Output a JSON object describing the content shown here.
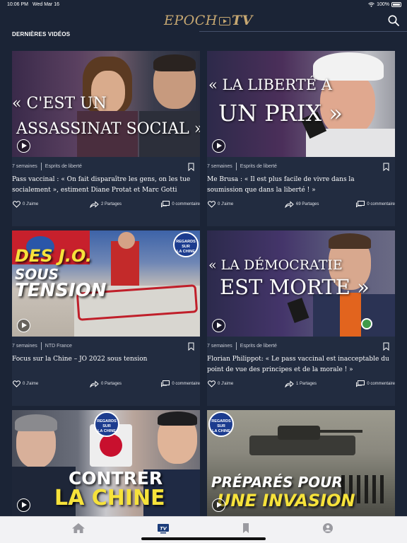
{
  "status": {
    "time": "10:06 PM",
    "date": "Wed Mar 16",
    "battery": "100%",
    "battery_level": 1.0
  },
  "header": {
    "logo_text": "EPOCH",
    "logo_tv": "TV",
    "search_icon": "search-icon"
  },
  "section": {
    "title": "DERNIÈRES VIDÉOS"
  },
  "cards": [
    {
      "age": "7 semaines",
      "category": "Esprits de liberté",
      "title": "Pass vaccinal : « On fait disparaître les gens, on les tue socialement », estiment  Diane Protat et Marc Gotti",
      "likes": "0 J'aime",
      "shares": "2 Partages",
      "comments": "0 commentaire",
      "thumb_line1": "« C'EST UN",
      "thumb_line2": "ASSASSINAT SOCIAL »"
    },
    {
      "age": "7 semaines",
      "category": "Esprits de liberté",
      "title": "Me Brusa : « Il est plus facile de vivre dans la soumission que dans la liberté ! »",
      "likes": "0 J'aime",
      "shares": "69 Partages",
      "comments": "0 commentaire",
      "thumb_line1": "« LA LIBERTÉ A",
      "thumb_line2": "UN PRIX »"
    },
    {
      "age": "7 semaines",
      "category": "NTD France",
      "title": "Focus sur la Chine – JO 2022 sous tension",
      "likes": "0 J'aime",
      "shares": "0 Partages",
      "comments": "0 commentaire",
      "thumb_line1": "DES J.O.",
      "thumb_line2": "SOUS",
      "thumb_line3": "TENSION",
      "badge_line1": "REGARDS",
      "badge_line2": "SUR",
      "badge_line3": "LA CHINE"
    },
    {
      "age": "7 semaines",
      "category": "Esprits de liberté",
      "title": "Florian Philippot: « Le pass vaccinal est inacceptable du point de vue des principes et de la morale ! »",
      "likes": "0 J'aime",
      "shares": "1 Partages",
      "comments": "0 commentaire",
      "thumb_line1": "« LA DÉMOCRATIE",
      "thumb_line2": "EST MORTE »"
    },
    {
      "thumb_line1": "CONTRER",
      "thumb_line2": "LA CHINE",
      "badge_line1": "REGARDS",
      "badge_line2": "SUR",
      "badge_line3": "LA CHINE"
    },
    {
      "thumb_line1": "PRÉPARÉS POUR",
      "thumb_line2": "UNE INVASION",
      "badge_line1": "REGARDS",
      "badge_line2": "SUR",
      "badge_line3": "LA CHINE"
    }
  ],
  "tabs": [
    {
      "icon": "home-icon"
    },
    {
      "icon": "tv-icon",
      "active": true
    },
    {
      "icon": "bookmark-icon"
    },
    {
      "icon": "profile-icon"
    }
  ],
  "colors": {
    "background": "#1b2436",
    "card": "#222c40",
    "logo_gold": "#c7a872",
    "active_tab": "#1c3d7a",
    "inactive_tab": "#9a9aa0"
  }
}
